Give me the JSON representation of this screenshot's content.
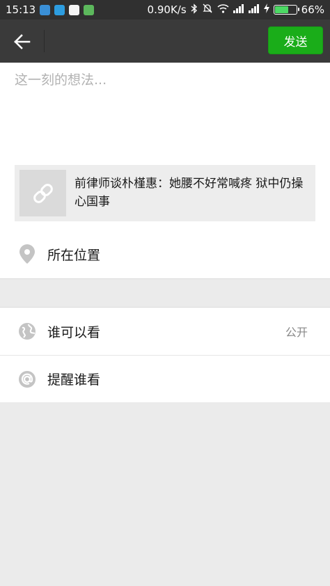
{
  "status_bar": {
    "time": "15:13",
    "speed": "0.90K/s",
    "battery_percent": "66%",
    "battery_level": 0.66,
    "colors": {
      "bar": "#303030",
      "battery": "#4cd964"
    }
  },
  "title_bar": {
    "send_label": "发送",
    "colors": {
      "bar": "#3a3a3a",
      "send": "#1aad19"
    }
  },
  "compose": {
    "placeholder": "这一刻的想法..."
  },
  "link_card": {
    "title": "前律师谈朴槿惠：她腰不好常喊疼 狱中仍操心国事",
    "icon": "link-icon"
  },
  "options": {
    "location": {
      "label": "所在位置",
      "icon": "location-pin-icon"
    },
    "visibility": {
      "label": "谁可以看",
      "value": "公开",
      "icon": "globe-icon"
    },
    "mention": {
      "label": "提醒谁看",
      "icon": "at-icon"
    }
  }
}
